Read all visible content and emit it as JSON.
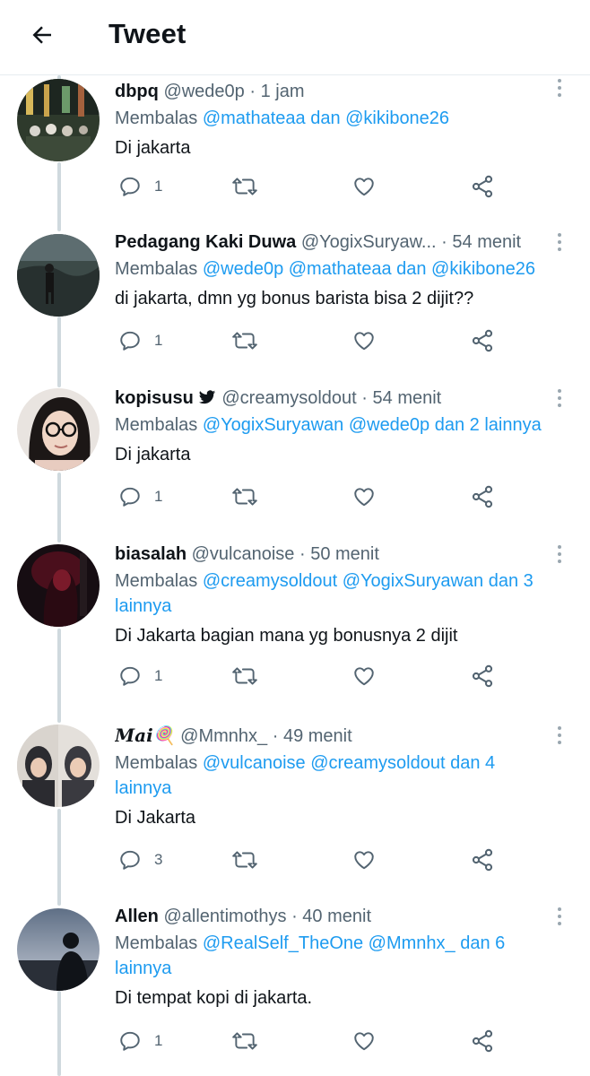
{
  "header": {
    "title": "Tweet",
    "back_icon": "arrow-left-icon"
  },
  "colors": {
    "link": "#1d9bf0",
    "secondary_text": "#536471",
    "primary_text": "#0f1419",
    "thread_line": "#cfd9de"
  },
  "tweets": [
    {
      "name": "dbpq",
      "handle": "@wede0p",
      "separator": "·",
      "time": "1 jam",
      "replying_prefix": "Membalas",
      "replying_mentions": "@mathateaa dan @kikibone26",
      "replying_rest": "",
      "text": "Di jakarta",
      "reply_count": "1"
    },
    {
      "name": "Pedagang Kaki Duwa",
      "handle": "@YogixSuryaw...",
      "separator": "·",
      "time": "54 menit",
      "replying_prefix": "Membalas",
      "replying_mentions": "@wede0p @mathateaa dan @kikibone26",
      "replying_rest": "",
      "text": "di jakarta, dmn yg bonus barista bisa 2 dijit??",
      "reply_count": "1"
    },
    {
      "name": "kopisusu",
      "handle": "@creamysoldout",
      "separator": "·",
      "time": "54 menit",
      "replying_prefix": "Membalas",
      "replying_mentions": "@YogixSuryawan @wede0p dan 2 lainnya",
      "replying_rest": "",
      "text": "Di jakarta",
      "reply_count": "1"
    },
    {
      "name": "biasalah",
      "handle": "@vulcanoise",
      "separator": "·",
      "time": "50 menit",
      "replying_prefix": "Membalas",
      "replying_mentions": "@creamysoldout @YogixSuryawan dan 3 lainnya",
      "replying_rest": "",
      "text": "Di Jakarta bagian mana yg bonusnya 2 dijit",
      "reply_count": "1"
    },
    {
      "name": "Mai🍭",
      "handle": "@Mmnhx_",
      "separator": "·",
      "time": "49 menit",
      "replying_prefix": "Membalas",
      "replying_mentions": "@vulcanoise @creamysoldout dan 4 lainnya",
      "replying_rest": "",
      "text": "Di Jakarta",
      "reply_count": "3"
    },
    {
      "name": "Allen",
      "handle": "@allentimothys",
      "separator": "·",
      "time": "40 menit",
      "replying_prefix": "Membalas",
      "replying_mentions": "@RealSelf_TheOne @Mmnhx_ dan 6 lainnya",
      "replying_rest": "",
      "text": "Di tempat kopi di jakarta.",
      "reply_count": "1"
    }
  ]
}
